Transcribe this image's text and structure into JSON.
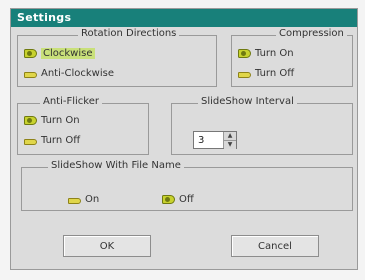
{
  "window": {
    "title": "Settings"
  },
  "rotation": {
    "legend": "Rotation Directions",
    "options": [
      {
        "label": "Clockwise",
        "selected": true
      },
      {
        "label": "Anti-Clockwise",
        "selected": false
      }
    ]
  },
  "compression": {
    "legend": "Compression",
    "options": [
      {
        "label": "Turn On",
        "selected": true
      },
      {
        "label": "Turn Off",
        "selected": false
      }
    ]
  },
  "antiflicker": {
    "legend": "Anti-Flicker",
    "options": [
      {
        "label": "Turn On",
        "selected": true
      },
      {
        "label": "Turn Off",
        "selected": false
      }
    ]
  },
  "slideshow_interval": {
    "legend": "SlideShow Interval",
    "value": "3"
  },
  "slideshow_filename": {
    "legend": "SlideShow With File Name",
    "options": [
      {
        "label": "On",
        "selected": false
      },
      {
        "label": "Off",
        "selected": true
      }
    ]
  },
  "buttons": {
    "ok": "OK",
    "cancel": "Cancel"
  },
  "colors": {
    "titlebar": "#18807a",
    "radio_selected": "#c8d22e",
    "radio_unselected": "#e0d64a"
  }
}
